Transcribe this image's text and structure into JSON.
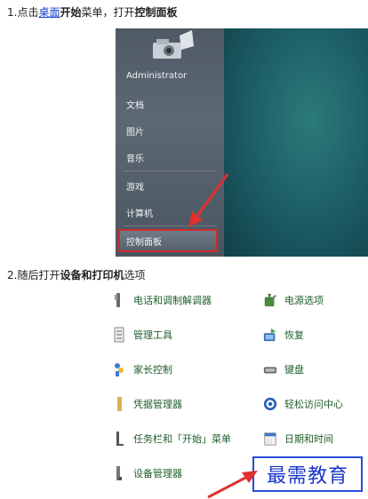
{
  "step1": {
    "prefix": "1.点击",
    "link": "桌面",
    "bold": "开始",
    "middle": "菜单，打开",
    "bold2": "控制面板"
  },
  "start_menu": {
    "items": [
      "Administrator",
      "文档",
      "图片",
      "音乐",
      "游戏",
      "计算机",
      "控制面板"
    ]
  },
  "step2": {
    "prefix": "2.随后打开",
    "bold": "设备和打印机",
    "suffix": "选项"
  },
  "control_panel": {
    "left": [
      "电话和调制解调器",
      "管理工具",
      "家长控制",
      "凭据管理器",
      "任务栏和「开始」菜单",
      "设备管理器"
    ],
    "right": [
      "电源选项",
      "恢复",
      "键盘",
      "轻松访问中心",
      "日期和时间"
    ]
  },
  "watermark": "最需教育",
  "colors": {
    "link": "#1a3fd0",
    "label": "#1e5d2b",
    "highlight": "#d22a2a",
    "watermark": "#1c36c8"
  }
}
